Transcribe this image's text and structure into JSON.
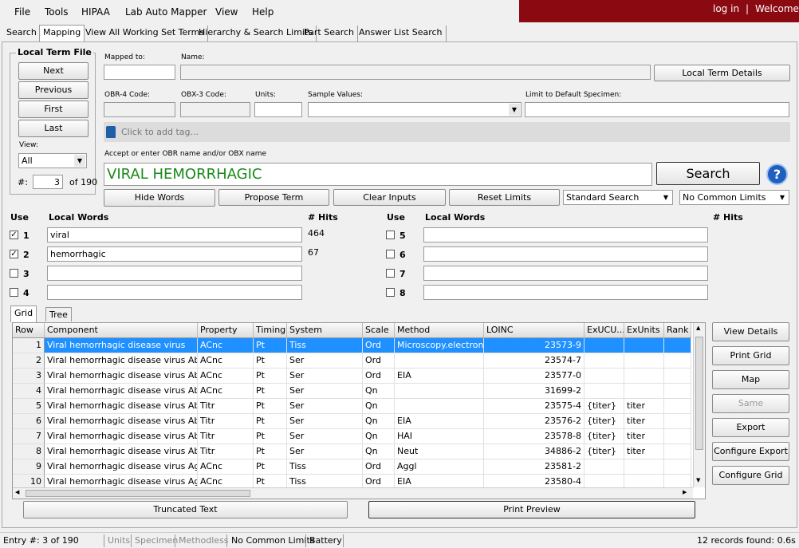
{
  "menu": {
    "items": [
      "File",
      "Tools",
      "HIPAA",
      "Lab Auto Mapper",
      "View",
      "Help"
    ],
    "login": "log in",
    "separator": "|",
    "welcome": "Welcome"
  },
  "tabs": [
    "Search",
    "Mapping",
    "View All Working Set Terms",
    "Hierarchy & Search Limits",
    "Part Search",
    "Answer List Search"
  ],
  "local_term_file": {
    "title": "Local Term File",
    "next": "Next",
    "previous": "Previous",
    "first": "First",
    "last": "Last",
    "view_label": "View:",
    "view_value": "All",
    "number_label": "#:",
    "number_value": "3",
    "of_total": "of 190"
  },
  "form": {
    "mapped_to_label": "Mapped to:",
    "mapped_to_value": "",
    "name_label": "Name:",
    "name_value": "",
    "local_term_details": "Local Term Details",
    "obr4_label": "OBR-4 Code:",
    "obx3_label": "OBX-3 Code:",
    "units_label": "Units:",
    "sample_values_label": "Sample Values:",
    "limit_label": "Limit to Default Specimen:",
    "tag_placeholder": "Click to add tag...",
    "accept_label": "Accept or enter OBR name and/or OBX name",
    "search_text": "VIRAL HEMORRHAGIC",
    "search_button": "Search",
    "help": "?"
  },
  "actions": {
    "hide_words": "Hide Words",
    "propose_term": "Propose Term",
    "clear_inputs": "Clear Inputs",
    "reset_limits": "Reset Limits",
    "search_mode": "Standard Search",
    "common_limits": "No Common Limits"
  },
  "words": {
    "use_header": "Use",
    "local_words_header": "Local Words",
    "hits_header": "# Hits",
    "left": [
      {
        "n": "1",
        "checked": true,
        "word": "viral",
        "hits": "464"
      },
      {
        "n": "2",
        "checked": true,
        "word": "hemorrhagic",
        "hits": "67"
      },
      {
        "n": "3",
        "checked": false,
        "word": "",
        "hits": ""
      },
      {
        "n": "4",
        "checked": false,
        "word": "",
        "hits": ""
      }
    ],
    "right": [
      {
        "n": "5",
        "checked": false,
        "word": "",
        "hits": ""
      },
      {
        "n": "6",
        "checked": false,
        "word": "",
        "hits": ""
      },
      {
        "n": "7",
        "checked": false,
        "word": "",
        "hits": ""
      },
      {
        "n": "8",
        "checked": false,
        "word": "",
        "hits": ""
      }
    ]
  },
  "grid_tabs": [
    "Grid",
    "Tree"
  ],
  "grid": {
    "columns": [
      "Row",
      "Component",
      "Property",
      "Timing",
      "System",
      "Scale",
      "Method",
      "LOINC",
      "ExUCU...",
      "ExUnits",
      "Rank"
    ],
    "rows": [
      [
        "1",
        "Viral hemorrhagic disease virus",
        "ACnc",
        "Pt",
        "Tiss",
        "Ord",
        "Microscopy.electron",
        "23573-9",
        "",
        "",
        ""
      ],
      [
        "2",
        "Viral hemorrhagic disease virus Ab",
        "ACnc",
        "Pt",
        "Ser",
        "Ord",
        "",
        "23574-7",
        "",
        "",
        ""
      ],
      [
        "3",
        "Viral hemorrhagic disease virus Ab",
        "ACnc",
        "Pt",
        "Ser",
        "Ord",
        "EIA",
        "23577-0",
        "",
        "",
        ""
      ],
      [
        "4",
        "Viral hemorrhagic disease virus Ab",
        "ACnc",
        "Pt",
        "Ser",
        "Qn",
        "",
        "31699-2",
        "",
        "",
        ""
      ],
      [
        "5",
        "Viral hemorrhagic disease virus Ab",
        "Titr",
        "Pt",
        "Ser",
        "Qn",
        "",
        "23575-4",
        "{titer}",
        "titer",
        ""
      ],
      [
        "6",
        "Viral hemorrhagic disease virus Ab",
        "Titr",
        "Pt",
        "Ser",
        "Qn",
        "EIA",
        "23576-2",
        "{titer}",
        "titer",
        ""
      ],
      [
        "7",
        "Viral hemorrhagic disease virus Ab",
        "Titr",
        "Pt",
        "Ser",
        "Qn",
        "HAI",
        "23578-8",
        "{titer}",
        "titer",
        ""
      ],
      [
        "8",
        "Viral hemorrhagic disease virus Ab",
        "Titr",
        "Pt",
        "Ser",
        "Qn",
        "Neut",
        "34886-2",
        "{titer}",
        "titer",
        ""
      ],
      [
        "9",
        "Viral hemorrhagic disease virus Ag",
        "ACnc",
        "Pt",
        "Tiss",
        "Ord",
        "Aggl",
        "23581-2",
        "",
        "",
        ""
      ],
      [
        "10",
        "Viral hemorrhagic disease virus Ag",
        "ACnc",
        "Pt",
        "Tiss",
        "Ord",
        "EIA",
        "23580-4",
        "",
        "",
        ""
      ]
    ]
  },
  "side_buttons": [
    "View Details",
    "Print Grid",
    "Map",
    "Same",
    "Export",
    "Configure Export",
    "Configure Grid"
  ],
  "bottom": {
    "truncated": "Truncated Text",
    "print_preview": "Print Preview"
  },
  "status": {
    "entry": "Entry #: 3 of 190",
    "units": "Units",
    "specimen": "Specimen",
    "methodless": "Methodless",
    "common_limits": "No Common Limits",
    "battery": "Battery",
    "records": "12 records found: 0.6s"
  }
}
